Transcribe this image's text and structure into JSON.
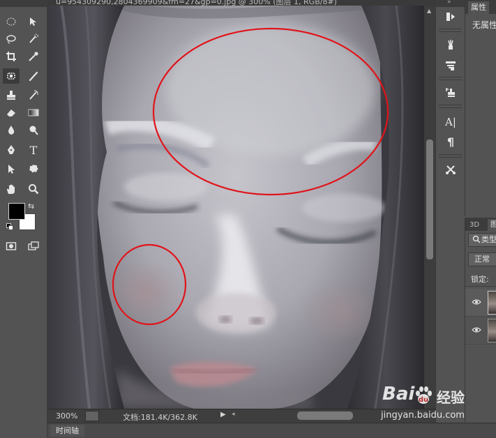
{
  "document": {
    "title": "u=954309290,2804369909&fm=27&gp=0.jpg @ 300% (图层 1, RGB/8#)"
  },
  "status": {
    "zoom": "300%",
    "doc_info": "文档:181.4K/362.8K"
  },
  "timeline": {
    "label": "时间轴"
  },
  "properties": {
    "tab": "属性",
    "empty_text": "无属性"
  },
  "layers": {
    "tab_3d": "3D",
    "tab_layers": "图",
    "filter_label": "类型",
    "blend_mode": "正常",
    "lock_label": "锁定:"
  },
  "watermark": {
    "brand": "Bai",
    "brand_cn": "经验",
    "url": "jingyan.baidu.com"
  },
  "colors": {
    "foreground": "#000000",
    "background": "#ffffff",
    "annotation": "#e0141a"
  }
}
